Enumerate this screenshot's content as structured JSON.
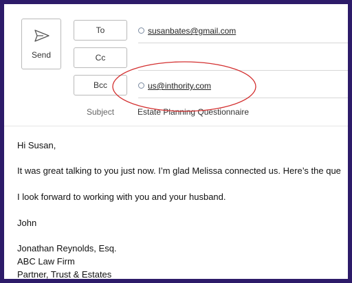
{
  "compose": {
    "send_label": "Send",
    "to_label": "To",
    "cc_label": "Cc",
    "bcc_label": "Bcc",
    "to_recipient": "susanbates@gmail.com",
    "bcc_recipient": "us@inthority.com",
    "subject_label": "Subject",
    "subject_value": "Estate Planning Questionnaire"
  },
  "body": {
    "greeting": "Hi Susan,",
    "paragraph1": "It was great talking to you just now. I’m glad Melissa connected us. Here’s the que",
    "paragraph2": "I look forward to working with you and your husband.",
    "closing_name": "John",
    "sig_name": "Jonathan Reynolds, Esq.",
    "sig_firm": "ABC Law Firm",
    "sig_title": "Partner, Trust & Estates"
  },
  "colors": {
    "frame": "#2d1b69",
    "annotation": "#d32f2f"
  }
}
